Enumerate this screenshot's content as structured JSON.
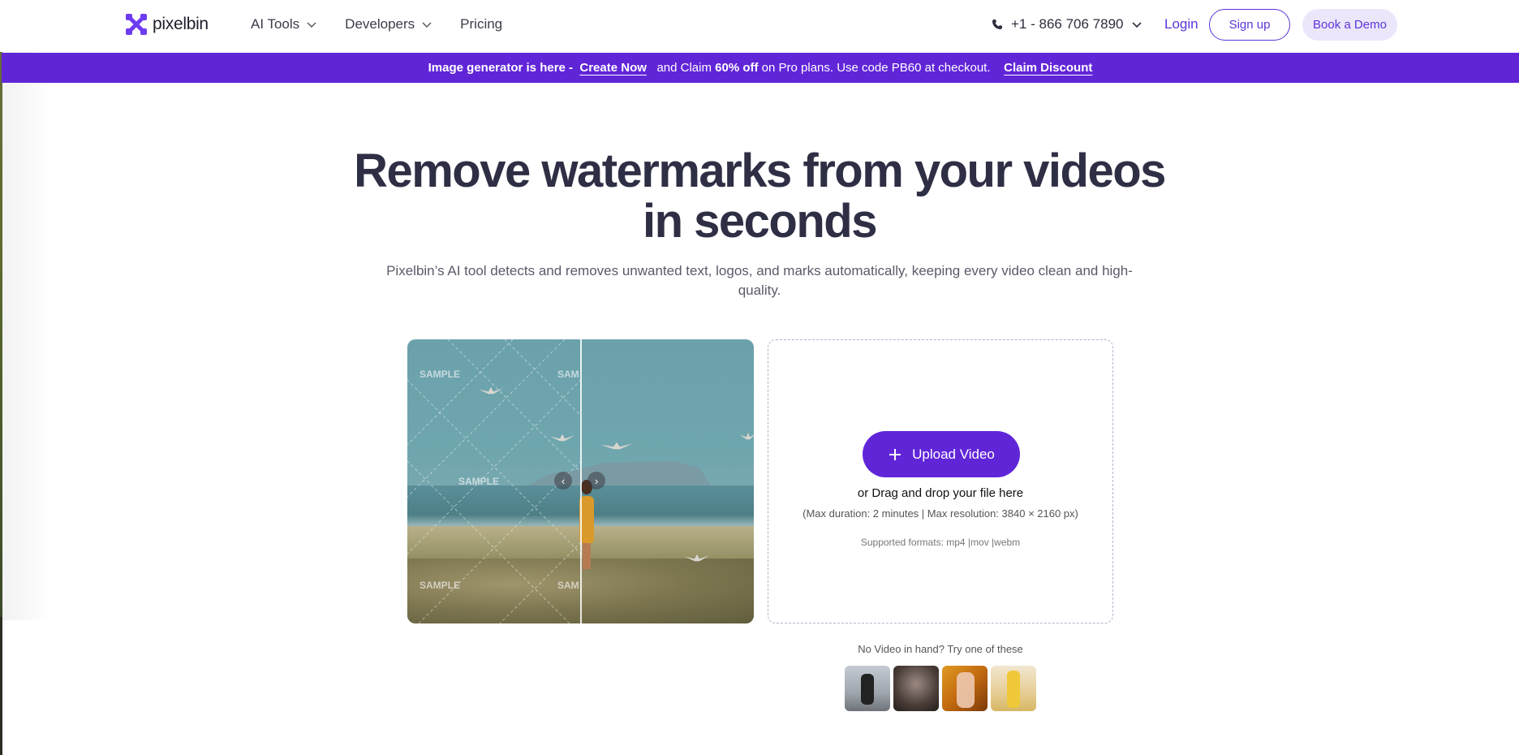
{
  "header": {
    "logo_text": "pixelbin",
    "nav": [
      {
        "label": "AI Tools",
        "has_dropdown": true
      },
      {
        "label": "Developers",
        "has_dropdown": true
      },
      {
        "label": "Pricing",
        "has_dropdown": false
      }
    ],
    "phone": "+1 - 866 706 7890",
    "login": "Login",
    "signup": "Sign up",
    "demo": "Book a Demo"
  },
  "banner": {
    "lead": "Image generator is here -",
    "create_now": "Create Now",
    "middle_1": "and Claim",
    "discount": "60% off",
    "middle_2": "on Pro plans. Use code PB60 at checkout.",
    "claim": "Claim Discount",
    "color": "#6125d8"
  },
  "hero": {
    "title_line1": "Remove watermarks from your videos",
    "title_line2": "in seconds",
    "subtitle": "Pixelbin’s AI tool detects and removes unwanted text, logos, and marks automatically, keeping every video clean and high-quality."
  },
  "preview": {
    "watermark_text": "SAMPLE",
    "watermark_text_cut": "SAM",
    "prev_arrow": "‹",
    "next_arrow": "›"
  },
  "upload": {
    "button_label": "Upload Video",
    "drag_text": "or Drag and drop your file here",
    "limits": "(Max duration: 2 minutes | Max resolution: 3840 × 2160 px)",
    "formats": "Supported formats: mp4 |mov |webm"
  },
  "samples": {
    "prompt": "No Video in hand? Try one of these",
    "count": 4
  },
  "colors": {
    "accent": "#6125d8",
    "accent_light": "#ece6fb",
    "title": "#2e2e45"
  }
}
